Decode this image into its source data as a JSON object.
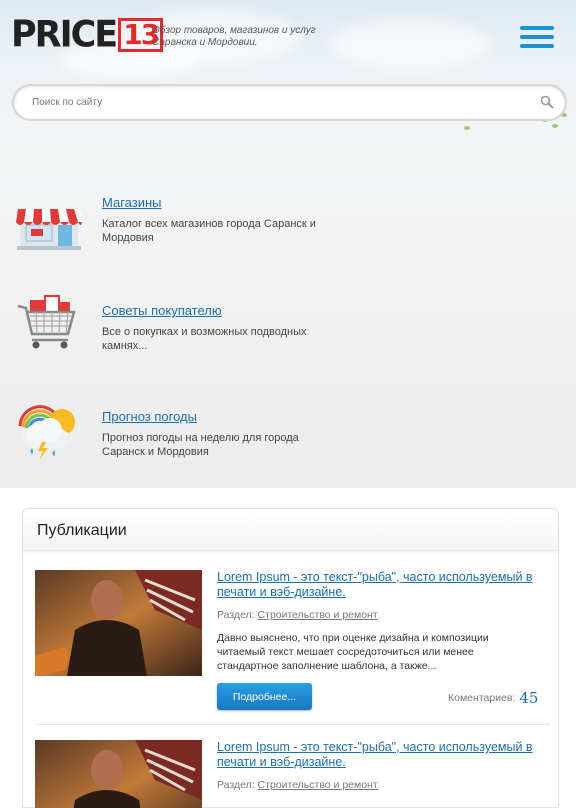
{
  "header": {
    "logo_text": "PRICE",
    "logo_number": "13",
    "tagline": "Обзор товаров, магазинов и услуг Саранска и Мордовии."
  },
  "search": {
    "placeholder": "Поиск по сайту"
  },
  "features": [
    {
      "title": "Магазины",
      "description": "Каталог всех магазинов города Саранск и Мордовия",
      "icon": "shop-icon"
    },
    {
      "title": "Советы покупателю",
      "description": "Все о покупках и возможных подводных камнях...",
      "icon": "shopping-cart-icon"
    },
    {
      "title": "Прогноз погоды",
      "description": "Прогноз погоды на неделю для города Саранск и Мордовия",
      "icon": "weather-icon"
    }
  ],
  "publications": {
    "title": "Публикации",
    "posts": [
      {
        "title": "Lorem Ipsum - это текст-\"рыба\", часто используемый в печати и вэб-дизайне.",
        "section_label": "Раздел:",
        "section": "Строительство и ремонт",
        "text": "Давно выяснено, что при оценке дизайна и композиции читаемый текст мешает сосредоточиться или менее стандартное заполнение шаблона, а также...",
        "button": "Подробнее...",
        "comments_label": "Коментариев:",
        "comments_count": "45"
      },
      {
        "title": "Lorem Ipsum - это текст-\"рыба\", часто используемый в печати и вэб-дизайне.",
        "section_label": "Раздел:",
        "section": "Строительство и ремонт"
      }
    ]
  },
  "colors": {
    "accent": "#1b93cf",
    "link": "#1b6fb1",
    "logo_red": "#e42a2a"
  }
}
